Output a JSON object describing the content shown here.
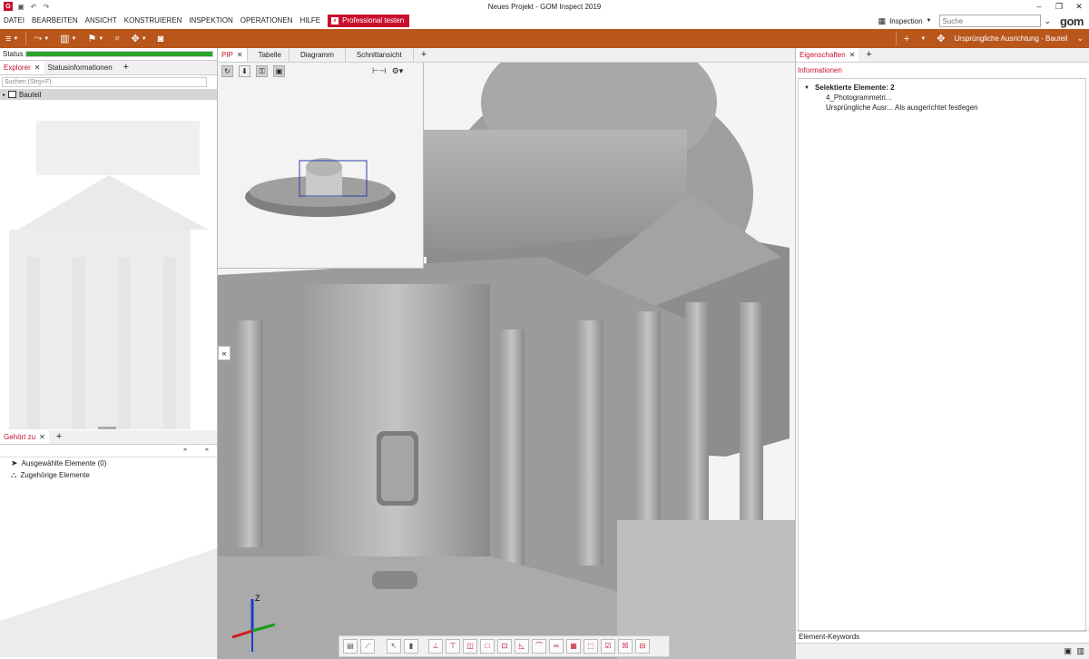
{
  "window": {
    "title": "Neues Projekt - GOM Inspect 2019",
    "logo_text": "G",
    "minimize": "–",
    "restore": "❐",
    "close": "✕"
  },
  "menu": {
    "items": [
      "DATEI",
      "BEARBEITEN",
      "ANSICHT",
      "KONSTRUIEREN",
      "INSPEKTION",
      "OPERATIONEN",
      "HILFE"
    ],
    "pro_button": "Professional testen",
    "workspace": "Inspection",
    "search_placeholder": "Suche",
    "brand": "gom"
  },
  "toolbar": {
    "alignment": "Ursprüngliche Ausrichtung - Bauteil"
  },
  "left": {
    "status_label": "Status",
    "status_progress": 1.0,
    "tabs": [
      "Explorer",
      "Statusinformationen"
    ],
    "search_placeholder": "Suchen (Strg+F)",
    "tree_root": "Bauteil",
    "lower_tab": "Gehört zu",
    "selected_elements": "Ausgewählte Elemente (0)",
    "related_elements": "Zugehörige Elemente"
  },
  "viewport": {
    "tabs": [
      "PIP",
      "Tabelle",
      "Diagramm",
      "Schnittansicht"
    ],
    "collapse": "«",
    "axis_z": "Z"
  },
  "right": {
    "tab": "Eigenschaften",
    "section": "Informationen",
    "selected_header": "Selektierte Elemente: 2",
    "item1": "4_Photogrammetri...",
    "item2_name": "Ursprüngliche Ausr...",
    "item2_value": "Als ausgerichtet festlegen",
    "keywords": "Element-Keywords"
  },
  "colors": {
    "accent": "#c8102e",
    "toolbar": "#b8561c",
    "status": "#2aa32a"
  }
}
